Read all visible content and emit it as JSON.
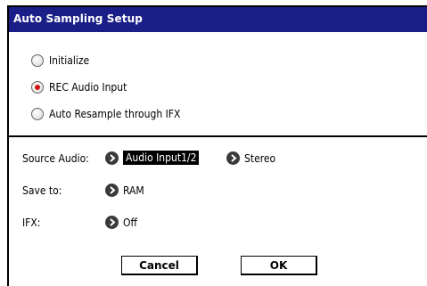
{
  "dialog": {
    "title": "Auto Sampling Setup"
  },
  "modes": [
    {
      "label": "Initialize",
      "selected": false
    },
    {
      "label": "REC Audio Input",
      "selected": true
    },
    {
      "label": "Auto Resample through IFX",
      "selected": false
    }
  ],
  "source_audio": {
    "label": "Source Audio:",
    "input": "Audio Input1/2",
    "channel": "Stereo"
  },
  "save_to": {
    "label": "Save to:",
    "value": "RAM"
  },
  "ifx": {
    "label": "IFX:",
    "value": "Off"
  },
  "buttons": {
    "cancel": "Cancel",
    "ok": "OK"
  },
  "colors": {
    "titlebar": "#1a1f87",
    "radio_selected": "#d11515"
  }
}
